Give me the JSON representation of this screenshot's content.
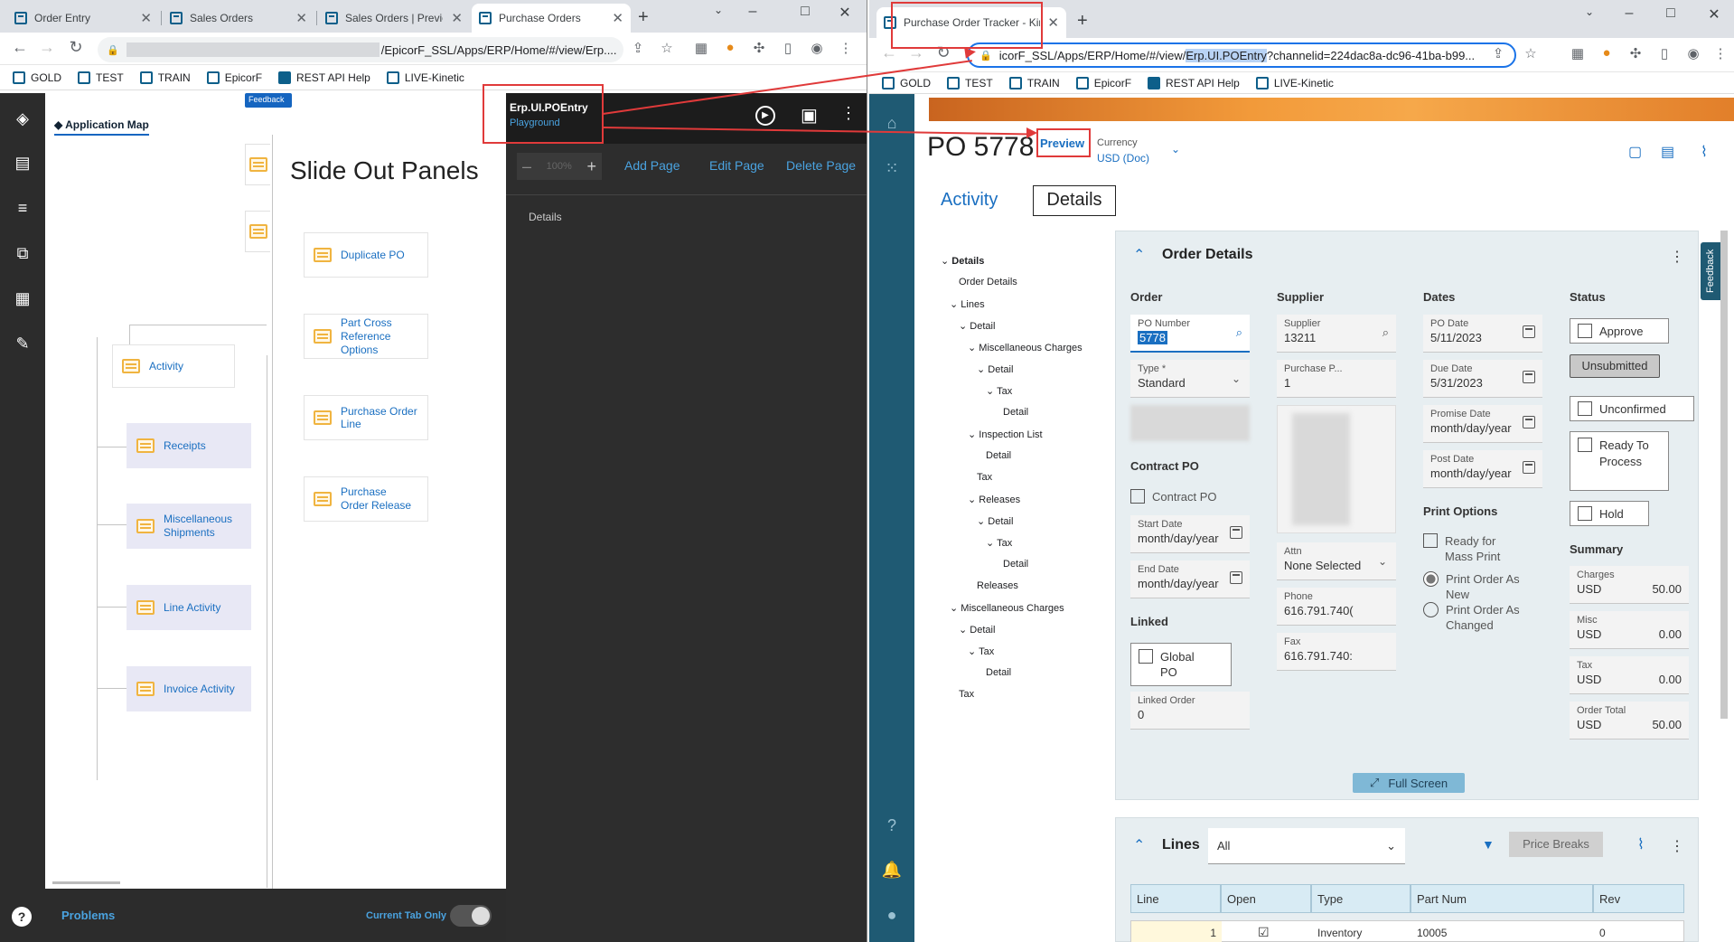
{
  "left": {
    "tabs": [
      {
        "label": "Order Entry"
      },
      {
        "label": "Sales Orders"
      },
      {
        "label": "Sales Orders | Previe"
      },
      {
        "label": "Purchase Orders"
      }
    ],
    "url": "/EpicorF_SSL/Apps/ERP/Home/#/view/Erp....",
    "bookmarks": [
      "GOLD",
      "TEST",
      "TRAIN",
      "EpicorF",
      "REST API Help",
      "LIVE-Kinetic"
    ],
    "feedback_label": "Feedback",
    "app_map_label": "Application Map",
    "slide_out_title": "Slide Out Panels",
    "app_map_nodes": [
      {
        "label": "Activity"
      },
      {
        "label": "Receipts"
      },
      {
        "label": "Miscellaneous Shipments"
      },
      {
        "label": "Line Activity"
      },
      {
        "label": "Invoice Activity"
      }
    ],
    "slide_out_nodes": [
      {
        "label": "Duplicate PO"
      },
      {
        "label": "Part Cross Reference Options"
      },
      {
        "label": "Purchase Order Line"
      },
      {
        "label": "Purchase Order Release"
      }
    ],
    "designer": {
      "view_name": "Erp.UI.POEntry",
      "layer_name": "Playground",
      "zoom": "100%",
      "add_page": "Add Page",
      "edit_page": "Edit Page",
      "delete_page": "Delete Page",
      "page_label": "Details"
    },
    "problems_label": "Problems",
    "current_tab_only_label": "Current Tab Only"
  },
  "right": {
    "tab_title": "Purchase Order Tracker - Kinetic",
    "url_prefix": "icorF_SSL/Apps/ERP/Home/#/view/",
    "url_highlight": "Erp.UI.POEntry",
    "url_suffix": "?channelid=224dac8a-dc96-41ba-b99...",
    "bookmarks": [
      "GOLD",
      "TEST",
      "TRAIN",
      "EpicorF",
      "REST API Help",
      "LIVE-Kinetic"
    ],
    "po_title": "PO 5778",
    "preview_label": "Preview",
    "currency_label": "Currency",
    "currency_value": "USD (Doc)",
    "tab_activity": "Activity",
    "tab_details": "Details",
    "tree": [
      {
        "label": "Details"
      },
      {
        "label": "Order Details"
      },
      {
        "label": "Lines"
      },
      {
        "label": "Detail"
      },
      {
        "label": "Miscellaneous Charges"
      },
      {
        "label": "Detail"
      },
      {
        "label": "Tax"
      },
      {
        "label": "Detail"
      },
      {
        "label": "Inspection List"
      },
      {
        "label": "Detail"
      },
      {
        "label": "Tax"
      },
      {
        "label": "Releases"
      },
      {
        "label": "Detail"
      },
      {
        "label": "Tax"
      },
      {
        "label": "Detail"
      },
      {
        "label": "Releases"
      },
      {
        "label": "Miscellaneous Charges"
      },
      {
        "label": "Detail"
      },
      {
        "label": "Tax"
      },
      {
        "label": "Detail"
      },
      {
        "label": "Tax"
      }
    ],
    "order_details_title": "Order Details",
    "feedback_side": "Feedback",
    "order": {
      "header": "Order",
      "po_number_label": "PO Number",
      "po_number_value": "5778",
      "type_label": "Type *",
      "type_value": "Standard",
      "contract_header": "Contract PO",
      "contract_chk": "Contract PO",
      "start_date_label": "Start Date",
      "start_date_value": "month/day/year",
      "end_date_label": "End Date",
      "end_date_value": "month/day/year",
      "linked_header": "Linked",
      "global_po": "Global PO",
      "linked_order_label": "Linked Order",
      "linked_order_value": "0"
    },
    "supplier": {
      "header": "Supplier",
      "supplier_label": "Supplier",
      "supplier_value": "13211",
      "purchase_point_label": "Purchase P...",
      "purchase_point_value": "1",
      "attn_label": "Attn",
      "attn_value": "None Selected",
      "phone_label": "Phone",
      "phone_value": "616.791.740(",
      "fax_label": "Fax",
      "fax_value": "616.791.740:"
    },
    "dates": {
      "header": "Dates",
      "po_date_label": "PO Date",
      "po_date_value": "5/11/2023",
      "due_date_label": "Due Date",
      "due_date_value": "5/31/2023",
      "promise_date_label": "Promise Date",
      "promise_date_value": "month/day/year",
      "post_date_label": "Post Date",
      "post_date_value": "month/day/year",
      "print_header": "Print Options",
      "ready_mass_print": "Ready for Mass Print",
      "print_as_new": "Print Order As New",
      "print_as_changed": "Print Order As Changed"
    },
    "status": {
      "header": "Status",
      "approve": "Approve",
      "unsubmitted": "Unsubmitted",
      "unconfirmed": "Unconfirmed",
      "ready_to_process": "Ready To Process",
      "hold": "Hold"
    },
    "summary": {
      "header": "Summary",
      "items": [
        {
          "label": "Charges",
          "currency": "USD",
          "value": "50.00"
        },
        {
          "label": "Misc",
          "currency": "USD",
          "value": "0.00"
        },
        {
          "label": "Tax",
          "currency": "USD",
          "value": "0.00"
        },
        {
          "label": "Order Total",
          "currency": "USD",
          "value": "50.00"
        }
      ]
    },
    "full_screen_label": "Full Screen",
    "lines": {
      "title": "Lines",
      "filter_value": "All",
      "price_breaks": "Price Breaks",
      "columns": [
        "Line",
        "Open",
        "Type",
        "Part Num",
        "Rev"
      ],
      "row": {
        "line": "1",
        "type": "Inventory",
        "part": "10005",
        "rev": "0"
      }
    }
  },
  "colors": {
    "accent": "#1a6fc1",
    "rail": "#1f5a73",
    "annotation": "#e03a3a"
  }
}
